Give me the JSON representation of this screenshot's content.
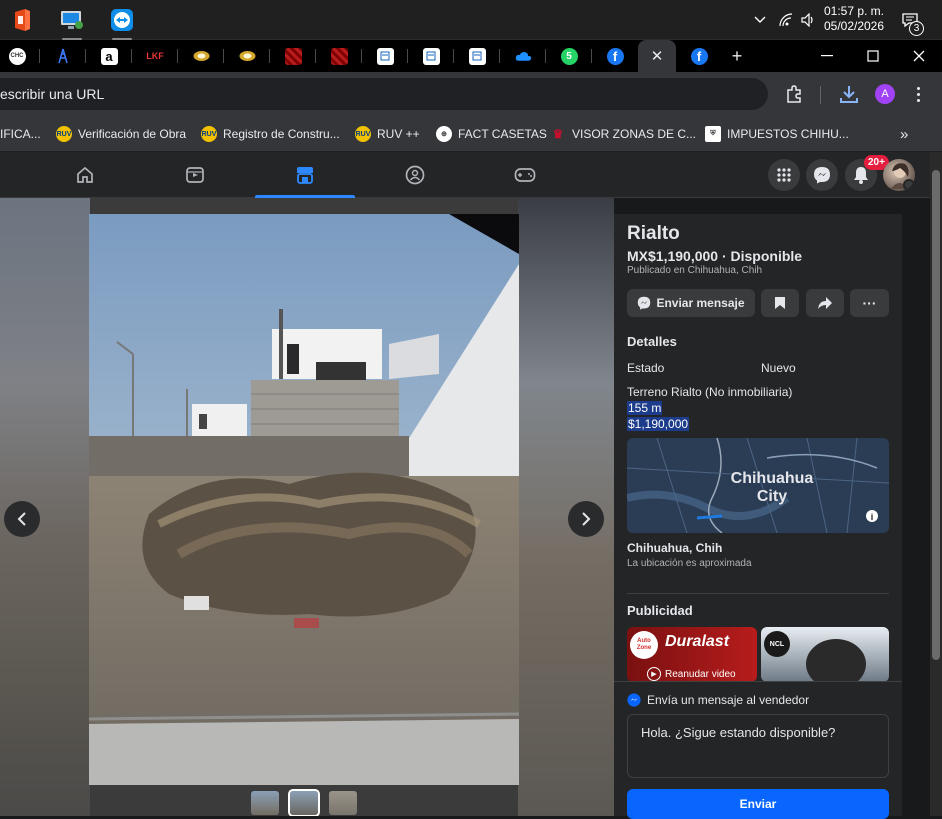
{
  "taskbar": {
    "apps": [
      {
        "name": "office-app"
      },
      {
        "name": "remote-desktop-app"
      },
      {
        "name": "teamviewer-app"
      }
    ],
    "time": "01:57 p. m.",
    "date": "05/02/2026",
    "notifications": "3"
  },
  "tabs": [
    {
      "icon": "chc",
      "label": "CHC"
    },
    {
      "icon": "tower",
      "label": ""
    },
    {
      "icon": "amazon",
      "label": "a"
    },
    {
      "icon": "lkf",
      "label": "LKF"
    },
    {
      "icon": "gold",
      "label": ""
    },
    {
      "icon": "gold",
      "label": ""
    },
    {
      "icon": "red-grid",
      "label": ""
    },
    {
      "icon": "red-grid",
      "label": ""
    },
    {
      "icon": "doc",
      "label": ""
    },
    {
      "icon": "doc",
      "label": ""
    },
    {
      "icon": "doc",
      "label": ""
    },
    {
      "icon": "onedrive",
      "label": ""
    },
    {
      "icon": "whatsapp",
      "label": "5"
    },
    {
      "icon": "facebook",
      "label": "f"
    },
    {
      "icon": "facebook",
      "label": "f"
    }
  ],
  "toolbar": {
    "url_placeholder": "escribir una URL",
    "profile_initial": "A"
  },
  "bookmarks": [
    {
      "label": "IFICA...",
      "color": "#ff6a00"
    },
    {
      "label": "Verificación de Obra",
      "color": "#f2c200"
    },
    {
      "label": "Registro de Constru...",
      "color": "#f2c200"
    },
    {
      "label": "RUV ++",
      "color": "#f2c200"
    },
    {
      "label": "FACT CASETAS",
      "color": "#ffffff"
    },
    {
      "label": "VISOR ZONAS DE C...",
      "color": "#c8102e"
    },
    {
      "label": "IMPUESTOS CHIHU...",
      "color": "#ffffff"
    }
  ],
  "bookmarks_more": "»",
  "fbnav": {
    "notif_badge": "20+"
  },
  "listing": {
    "title": "Rialto",
    "price": "MX$1,190,000 · Disponible",
    "published": "Publicado en Chihuahua, Chih",
    "send_message": "Enviar mensaje",
    "more": "···",
    "details_heading": "Detalles",
    "condition_label": "Estado",
    "condition_value": "Nuevo",
    "description_line1": "Terreno Rialto (No inmobiliaria)",
    "description_line2": "155 m",
    "description_line3": "$1,190,000",
    "map_label_line1": "Chihuahua",
    "map_label_line2": "City",
    "location": "Chihuahua, Chih",
    "location_note": "La ubicación es aproximada",
    "ads_heading": "Publicidad",
    "ad1_brand": "Duralast",
    "ad1_cta": "Reanudar video",
    "ad1_logo": "Auto Zone",
    "ad2_logo": "NCL"
  },
  "message": {
    "prompt": "Envía un mensaje al vendedor",
    "text": "Hola. ¿Sigue estando disponible?",
    "send": "Enviar"
  },
  "colors": {
    "accent": "#0866ff",
    "nav_active": "#2d88ff",
    "badge": "#e41e3f",
    "panel": "#242526"
  }
}
